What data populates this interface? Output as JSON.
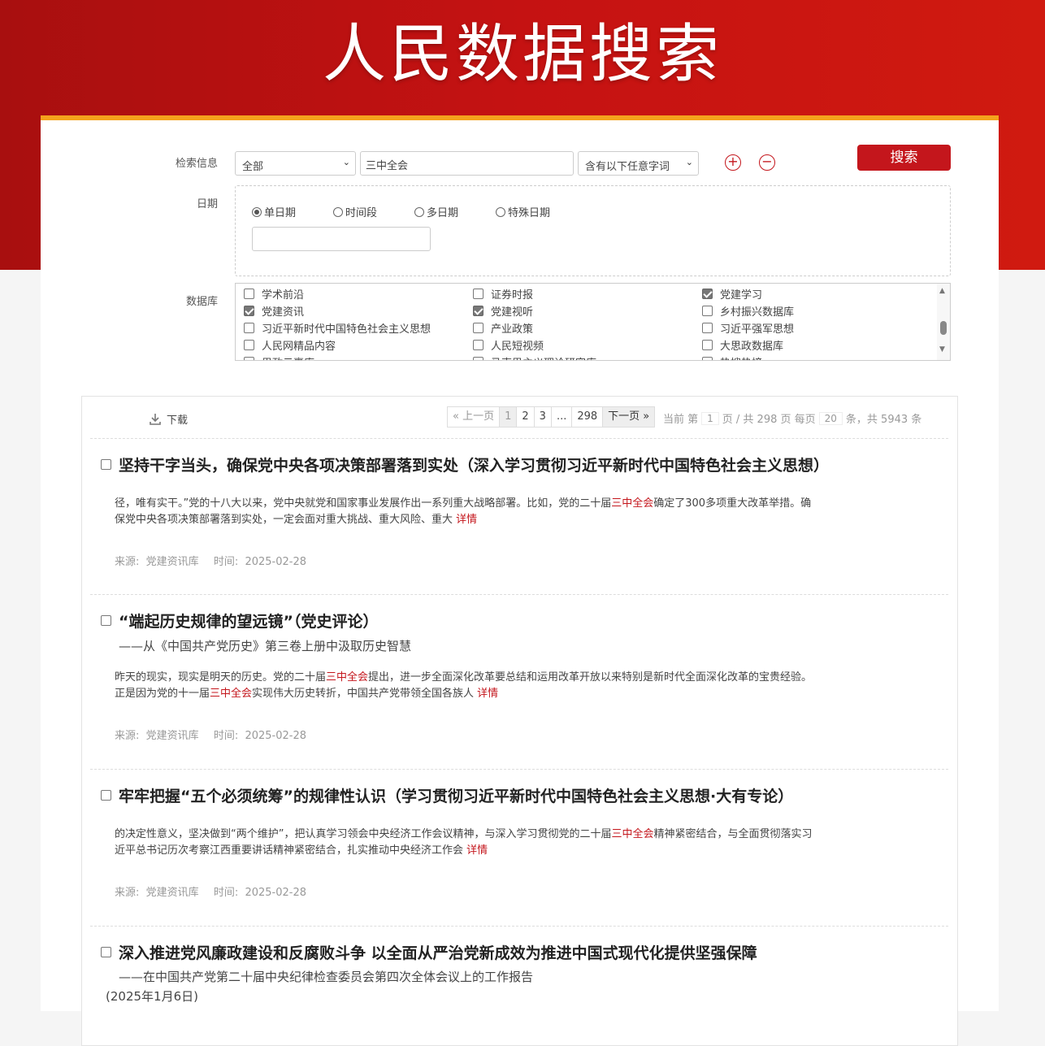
{
  "header": {
    "title": "人民数据搜索"
  },
  "search": {
    "label": "检索信息",
    "scope_selected": "全部",
    "keyword": "三中全会",
    "match_selected": "含有以下任意字词",
    "add_icon": "plus-circle-icon",
    "remove_icon": "minus-circle-icon",
    "button_label": "搜索"
  },
  "date": {
    "label": "日期",
    "options": [
      {
        "label": "单日期",
        "checked": true
      },
      {
        "label": "时间段",
        "checked": false
      },
      {
        "label": "多日期",
        "checked": false
      },
      {
        "label": "特殊日期",
        "checked": false
      }
    ],
    "value": ""
  },
  "databases": {
    "label": "数据库",
    "items": [
      {
        "label": "学术前沿",
        "checked": false
      },
      {
        "label": "证券时报",
        "checked": false
      },
      {
        "label": "党建学习",
        "checked": true
      },
      {
        "label": "党建资讯",
        "checked": true
      },
      {
        "label": "党建视听",
        "checked": true
      },
      {
        "label": "乡村振兴数据库",
        "checked": false
      },
      {
        "label": "习近平新时代中国特色社会主义思想",
        "checked": false
      },
      {
        "label": "产业政策",
        "checked": false
      },
      {
        "label": "习近平强军思想",
        "checked": false
      },
      {
        "label": "人民网精品内容",
        "checked": false
      },
      {
        "label": "人民短视频",
        "checked": false
      },
      {
        "label": "大思政数据库",
        "checked": false
      },
      {
        "label": "思政云裹库",
        "checked": false
      },
      {
        "label": "马克思主义理论研究库",
        "checked": false
      },
      {
        "label": "热搜热榜",
        "checked": false
      }
    ]
  },
  "toolbar": {
    "download_label": "下载"
  },
  "pager": {
    "prev": "« 上一页",
    "pages": [
      "1",
      "2",
      "3",
      "...",
      "298"
    ],
    "next": "下一页 »",
    "info_prefix": "当前 第",
    "current_page": "1",
    "info_mid": "页 / 共 298 页 每页",
    "per_page": "20",
    "info_suffix": "条，共 5943 条"
  },
  "results": [
    {
      "title": "坚持干字当头，确保党中央各项决策部署落到实处（深入学习贯彻习近平新时代中国特色社会主义思想）",
      "subtitle": "",
      "subtitle2": "",
      "snippet_parts": [
        "径，唯有实干。”党的十八大以来，党中央就党和国家事业发展作出一系列重大战略部署。比如，党的二十届",
        "三中全会",
        "确定了300多项重大改革举措。确保党中央各项决策部署落到实处，一定会面对重大挑战、重大风险、重大 "
      ],
      "more": "详情",
      "source_label": "来源:",
      "source": "党建资讯库",
      "time_label": "时间:",
      "time": "2025-02-28"
    },
    {
      "title": "“端起历史规律的望远镜”（党史评论）",
      "subtitle": "——从《中国共产党历史》第三卷上册中汲取历史智慧",
      "subtitle2": "",
      "snippet_parts": [
        "昨天的现实，现实是明天的历史。党的二十届",
        "三中全会",
        "提出，进一步全面深化改革要总结和运用改革开放以来特别是新时代全面深化改革的宝贵经验。正是因为党的十一届",
        "三中全会",
        "实现伟大历史转折，中国共产党带领全国各族人 "
      ],
      "more": "详情",
      "source_label": "来源:",
      "source": "党建资讯库",
      "time_label": "时间:",
      "time": "2025-02-28"
    },
    {
      "title": "牢牢把握“五个必须统筹”的规律性认识（学习贯彻习近平新时代中国特色社会主义思想·大有专论）",
      "subtitle": "",
      "subtitle2": "",
      "snippet_parts": [
        "的决定性意义，坚决做到“两个维护”，把认真学习领会中央经济工作会议精神，与深入学习贯彻党的二十届",
        "三中全会",
        "精神紧密结合，与全面贯彻落实习近平总书记历次考察江西重要讲话精神紧密结合，扎实推动中央经济工作会 "
      ],
      "more": "详情",
      "source_label": "来源:",
      "source": "党建资讯库",
      "time_label": "时间:",
      "time": "2025-02-28"
    },
    {
      "title": "深入推进党风廉政建设和反腐败斗争 以全面从严治党新成效为推进中国式现代化提供坚强保障",
      "subtitle": "——在中国共产党第二十届中央纪律检查委员会第四次全体会议上的工作报告",
      "subtitle2": "(2025年1月6日)",
      "snippet_parts": [],
      "more": "",
      "source_label": "",
      "source": "",
      "time_label": "",
      "time": ""
    }
  ]
}
